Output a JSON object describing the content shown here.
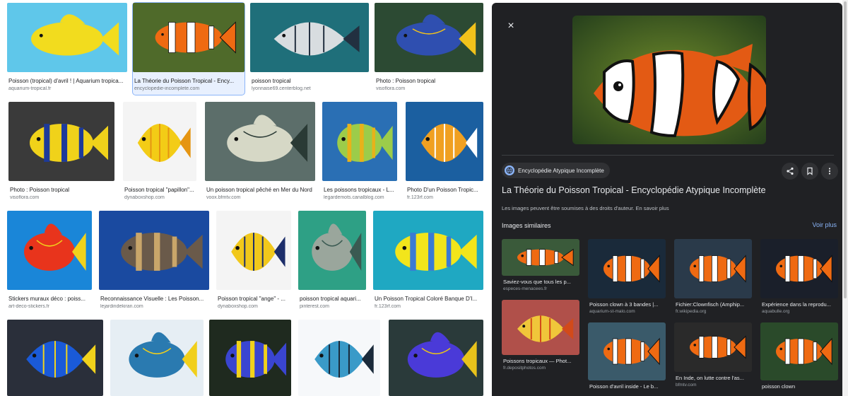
{
  "grid": {
    "results": [
      {
        "caption": "Poisson (tropical) d'avril ! | Aquarium tropica...",
        "source": "aquarium-tropical.fr",
        "bg": "#5fc7ea",
        "fish": "#f2dc1e",
        "stripe": "#f2dc1e"
      },
      {
        "caption": "La Théorie du Poisson Tropical - Ency...",
        "source": "encyclopedie-incomplete.com",
        "bg": "#4f6a2a",
        "fish": "#e2581b",
        "stripe": "#ffffff",
        "selected": true
      },
      {
        "caption": "poisson tropical",
        "source": "lyonnaise69.centerblog.net",
        "bg": "#1f6f7a",
        "fish": "#d8dde0",
        "stripe": "#223040"
      },
      {
        "caption": "Photo : Poisson tropical",
        "source": "visoflora.com",
        "bg": "#2c4a33",
        "fish": "#2f4fb0",
        "stripe": "#f1c21b"
      },
      {
        "caption": "Photo : Poisson tropical",
        "source": "visoflora.com",
        "bg": "#3a3a3a",
        "fish": "#f0d21a",
        "stripe": "#1d3a9a"
      },
      {
        "caption": "Poisson tropical \"papillon\"...",
        "source": "dynaboxshop.com",
        "bg": "#f4f4f4",
        "fish": "#f3cc16",
        "stripe": "#e59512"
      },
      {
        "caption": "Un poisson tropical pêché en Mer du Nord",
        "source": "voox.bfmtv.com",
        "bg": "#5c6e6a",
        "fish": "#d6d8c6",
        "stripe": "#2a3a35"
      },
      {
        "caption": "Les poissons tropicaux - L...",
        "source": "legardemots.canalblog.com",
        "bg": "#2a6fb4",
        "fish": "#9ccc4a",
        "stripe": "#e8b21a"
      },
      {
        "caption": "Photo D'un Poisson Tropic...",
        "source": "fr.123rf.com",
        "bg": "#1b5fa0",
        "fish": "#f0a021",
        "stripe": "#ffffff"
      },
      {
        "caption": "Stickers muraux déco : poiss...",
        "source": "art-deco-stickers.fr",
        "bg": "#1a86d8",
        "fish": "#e8341c",
        "stripe": "#f1d21b"
      },
      {
        "caption": "Reconnaissance Visuelle : Les Poisson...",
        "source": "lejardindekiran.com",
        "bg": "#1a4aa0",
        "fish": "#6a5a4a",
        "stripe": "#c9a66a"
      },
      {
        "caption": "Poisson tropical \"ange\" - ...",
        "source": "dynaboxshop.com",
        "bg": "#f4f4f4",
        "fish": "#f1c81b",
        "stripe": "#1d2e6a"
      },
      {
        "caption": "poisson tropical aquari...",
        "source": "pinterest.com",
        "bg": "#2ea085",
        "fish": "#9aa69c",
        "stripe": "#3a5a52"
      },
      {
        "caption": "Un Poisson Tropical Coloré Banque D'I...",
        "source": "fr.123rf.com",
        "bg": "#1fa8c2",
        "fish": "#f2e51b",
        "stripe": "#3a7ad4"
      },
      {
        "caption": "",
        "source": "",
        "bg": "#2a2f3a",
        "fish": "#1a5ad8",
        "stripe": "#f1d21b"
      },
      {
        "caption": "",
        "source": "",
        "bg": "#e6eef4",
        "fish": "#2a7ab0",
        "stripe": "#f1cf1b"
      },
      {
        "caption": "",
        "source": "",
        "bg": "#1f2a1f",
        "fish": "#3a45d0",
        "stripe": "#f1d21b"
      },
      {
        "caption": "",
        "source": "",
        "bg": "#f6f8fa",
        "fish": "#3a9ac8",
        "stripe": "#1a2a3a"
      },
      {
        "caption": "",
        "source": "",
        "bg": "#2a3a3a",
        "fish": "#4a3ad8",
        "stripe": "#e8c21b"
      }
    ]
  },
  "panel": {
    "close_label": "×",
    "source_name": "Encyclopédie Atypique Incomplète",
    "title": "La Théorie du Poisson Tropical - Encyclopédie Atypique Incomplète",
    "rights_text": "Les images peuvent être soumises à des droits d'auteur.",
    "rights_more": "En savoir plus",
    "similar_heading": "Images similaires",
    "see_all": "Voir plus",
    "similar": [
      {
        "caption": "Saviez-vous que tous les p...",
        "source": "especes-menacees.fr",
        "bg": "#3a5a3a"
      },
      {
        "caption": "Poisson clown à 3 bandes |...",
        "source": "aquarium-st-malo.com",
        "bg": "#1a2a3a"
      },
      {
        "caption": "Fichier:Clownfisch (Amphip...",
        "source": "fr.wikipedia.org",
        "bg": "#2a3a4a"
      },
      {
        "caption": "Expérience dans la reprodu...",
        "source": "aquabulle.org",
        "bg": "#1a1f2a"
      },
      {
        "caption": "Poissons tropicaux — Phot...",
        "source": "fr.depositphotos.com",
        "bg": "#b0504a"
      },
      {
        "caption": "Poisson d'avril inside - Le b...",
        "source": "",
        "bg": "#3a5a6a"
      },
      {
        "caption": "En Inde, on lutte contre l'as...",
        "source": "bfmtv.com",
        "bg": "#2a2a2a"
      },
      {
        "caption": "poisson clown",
        "source": "",
        "bg": "#2a4a2a"
      }
    ]
  }
}
